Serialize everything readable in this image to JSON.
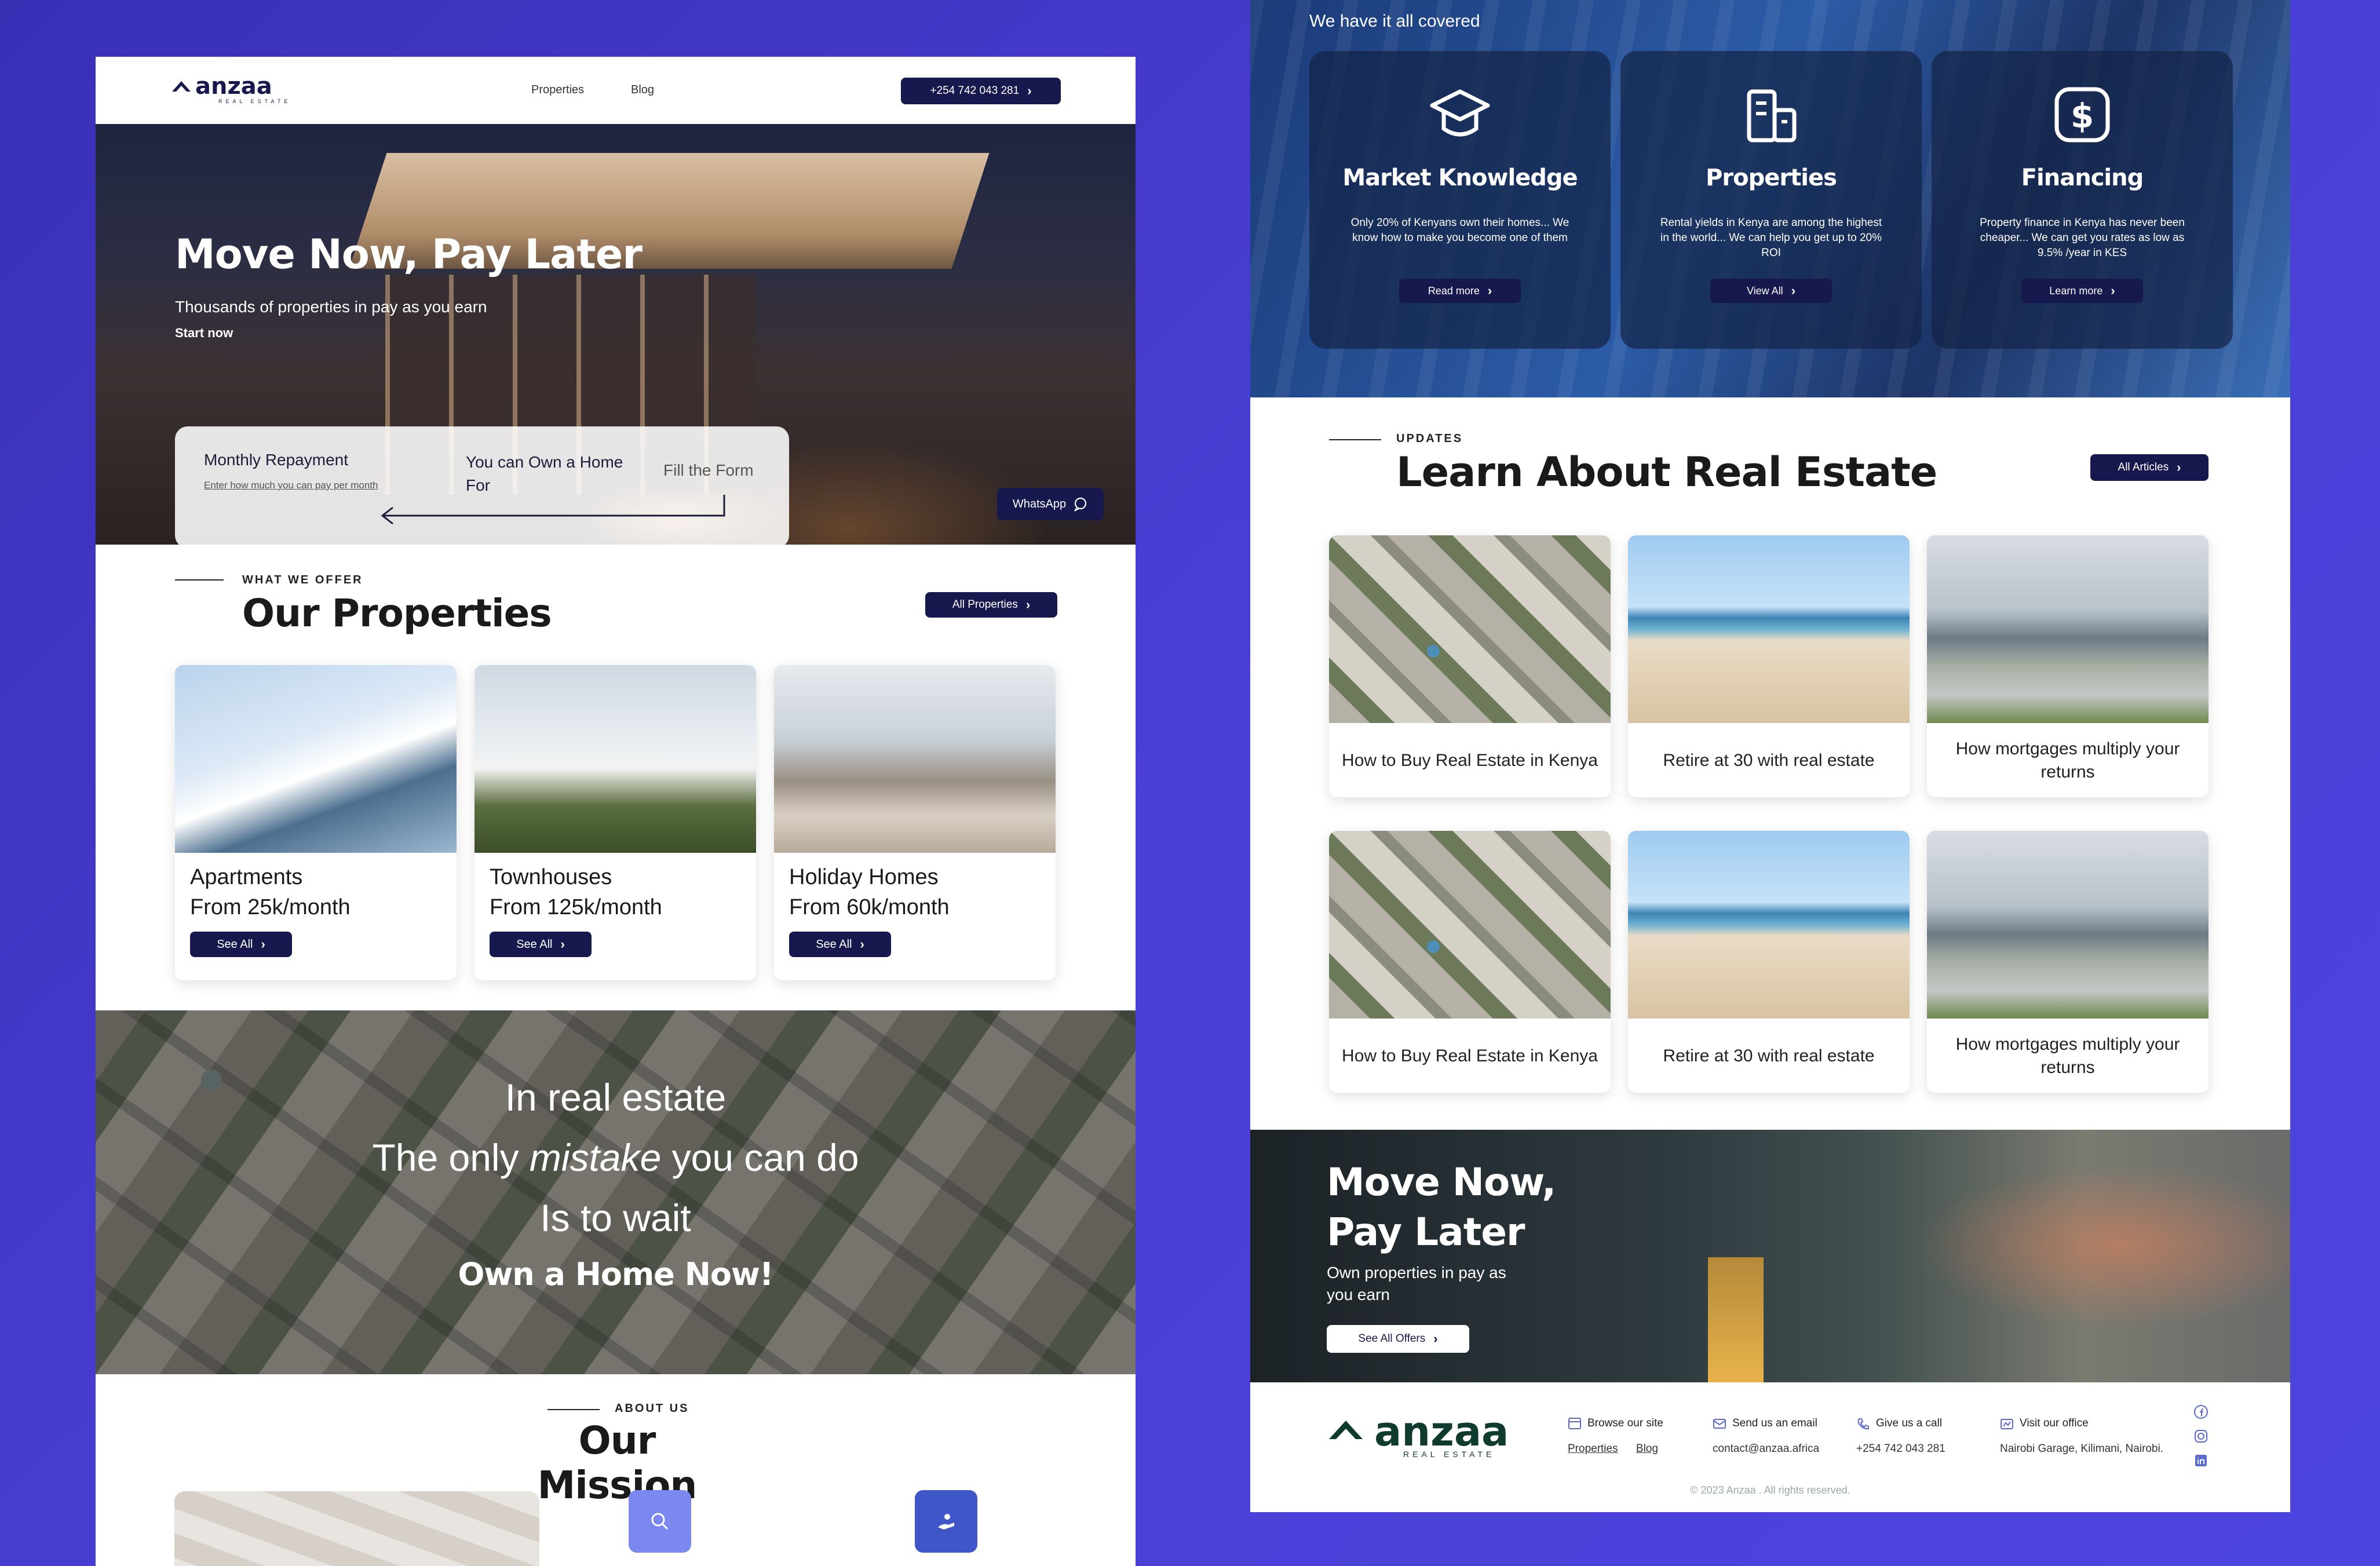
{
  "left": {
    "nav": {
      "logo": "anzaa",
      "logo_sub": "REAL ESTATE",
      "links": [
        "Properties",
        "Blog"
      ],
      "phone": "+254 742 043 281"
    },
    "hero": {
      "title": "Move Now, Pay Later",
      "subtitle": "Thousands of properties in pay as you earn",
      "start": "Start now",
      "calc": {
        "label_repayment": "Monthly Repayment",
        "hint": "Enter how much you can pay per month",
        "label_own": "You can Own a Home For",
        "label_form": "Fill the Form"
      },
      "whatsapp": "WhatsApp"
    },
    "properties": {
      "eyebrow": "WHAT WE OFFER",
      "title": "Our Properties",
      "all_button": "All Properties",
      "cards": [
        {
          "name": "Apartments",
          "price": "From 25k/month",
          "button": "See All"
        },
        {
          "name": "Townhouses",
          "price": "From 125k/month",
          "button": "See All"
        },
        {
          "name": "Holiday Homes",
          "price": "From 60k/month",
          "button": "See All"
        }
      ]
    },
    "banner": {
      "line1": "In real estate",
      "line2_pre": "The only ",
      "line2_em": "mistake",
      "line2_post": " you can do",
      "line3": "Is to wait",
      "line4": "Own a Home Now!"
    },
    "mission": {
      "eyebrow": "ABOUT US",
      "title": "Our Mission",
      "icons": [
        "search-icon",
        "hand-coin-icon"
      ]
    }
  },
  "right": {
    "covered": {
      "lead": "We have it all covered",
      "cards": [
        {
          "title": "Market Knowledge",
          "desc": "Only 20% of Kenyans own their homes... We know how to make you become one of them",
          "button": "Read more",
          "icon": "graduation-cap-icon"
        },
        {
          "title": "Properties",
          "desc": "Rental yields in Kenya are among the highest in the world... We can help you get up to 20% ROI",
          "button": "View All",
          "icon": "buildings-icon"
        },
        {
          "title": "Financing",
          "desc": "Property finance in Kenya has never been cheaper... We can get you rates as low as 9.5% /year in KES",
          "button": "Learn more",
          "icon": "dollar-icon"
        }
      ]
    },
    "updates": {
      "eyebrow": "UPDATES",
      "title": "Learn About Real Estate",
      "all_button": "All Articles",
      "articles": [
        "How to Buy Real Estate in Kenya",
        "Retire at 30 with real estate",
        "How mortgages multiply your returns",
        "How to Buy Real Estate in Kenya",
        "Retire at 30 with real estate",
        "How mortgages multiply your returns"
      ]
    },
    "cta": {
      "title_line1": "Move Now,",
      "title_line2": "Pay Later",
      "subtitle": "Own properties in pay as you earn",
      "button": "See All Offers"
    },
    "footer": {
      "logo": "anzaa",
      "logo_sub": "REAL ESTATE",
      "browse_head": "Browse our site",
      "browse_links": [
        "Properties",
        "Blog"
      ],
      "email_head": "Send us an email",
      "email": "contact@anzaa.africa",
      "call_head": "Give us a call",
      "phone": "+254 742 043 281",
      "office_head": "Visit our office",
      "office": "Nairobi Garage, Kilimani, Nairobi.",
      "copyright": "© 2023 Anzaa . All rights reserved.",
      "social": [
        "facebook-icon",
        "instagram-icon",
        "linkedin-icon"
      ]
    }
  },
  "colors": {
    "navy": "#17194e",
    "background": "#4338ca",
    "mission_icon_1": "#7b88f0",
    "mission_icon_2": "#3f56c8",
    "footer_logo": "#0f3b2e"
  }
}
